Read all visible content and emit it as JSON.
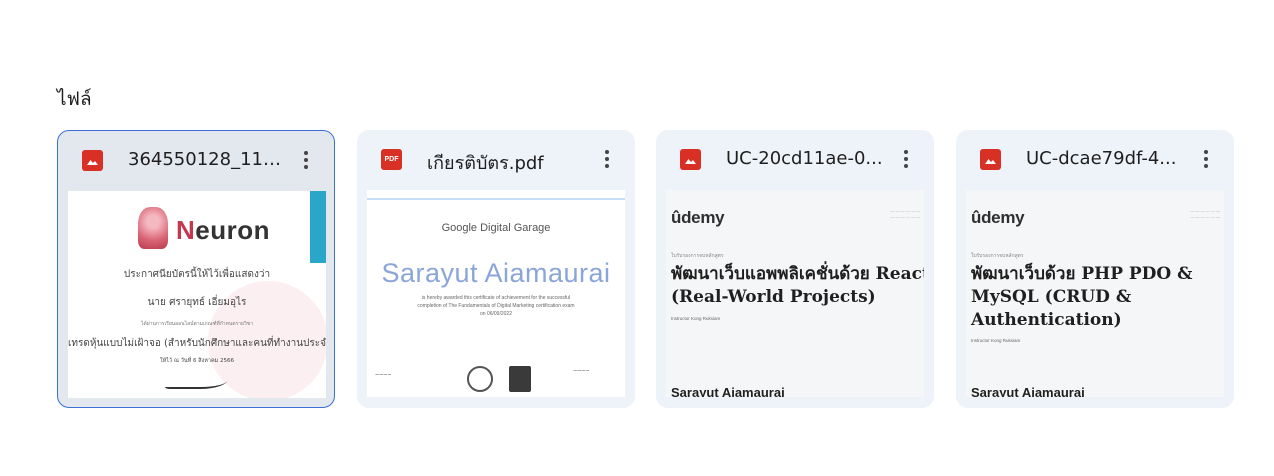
{
  "section": {
    "title": "ไฟล์"
  },
  "files": [
    {
      "name": "364550128_1114...",
      "type": "image",
      "icon": "image-icon",
      "icon_color": "#d93025",
      "selected": true,
      "thumb": {
        "brand": "euron",
        "brand_initial": "N",
        "line1": "ประกาศนียบัตรนี้ให้ไว้เพื่อแสดงว่า",
        "line2": "นาย ศรายุทธ์ เอี่ยมอุไร",
        "line3": "ได้ผ่านการเรียนออนไลน์ตามเกณฑ์ที่กำหนดรายวิชา",
        "line4": "เทรดหุ้นแบบไม่เฝ้าจอ (สำหรับนักศึกษาและคนที่ทำงานประจำ",
        "line5": "ให้ไว้ ณ วันที่   6 สิงหาคม 2566"
      }
    },
    {
      "name": "เกียรติบัตร.pdf",
      "type": "pdf",
      "icon": "pdf-icon",
      "icon_label": "PDF",
      "icon_color": "#d93025",
      "selected": false,
      "thumb": {
        "header": "Google Digital Garage",
        "name": "Sarayut Aiamaurai",
        "line1": "is hereby awarded this certificate of achievement for the successful",
        "line2": "completion of The Fundamentals of Digital Marketing certification exam",
        "line3": "on 06/09/2022"
      }
    },
    {
      "name": "UC-20cd11ae-0...",
      "type": "image",
      "icon": "image-icon",
      "icon_color": "#d93025",
      "selected": false,
      "thumb": {
        "logo": "ûdemy",
        "course_label": "ใบรับรองการจบหลักสูตร",
        "title": "พัฒนาเว็บแอพพลิเคชั่นด้วย React (Real-World Projects)",
        "instructor": "Instructor  Kong Ruksiam",
        "name": "Sarayut Aiamaurai"
      }
    },
    {
      "name": "UC-dcae79df-4...",
      "type": "image",
      "icon": "image-icon",
      "icon_color": "#d93025",
      "selected": false,
      "thumb": {
        "logo": "ûdemy",
        "course_label": "ใบรับรองการจบหลักสูตร",
        "title": "พัฒนาเว็บด้วย PHP PDO & MySQL (CRUD & Authentication)",
        "instructor": "Instructor  Kong Ruksiam",
        "name": "Sarayut Aiamaurai"
      }
    }
  ]
}
